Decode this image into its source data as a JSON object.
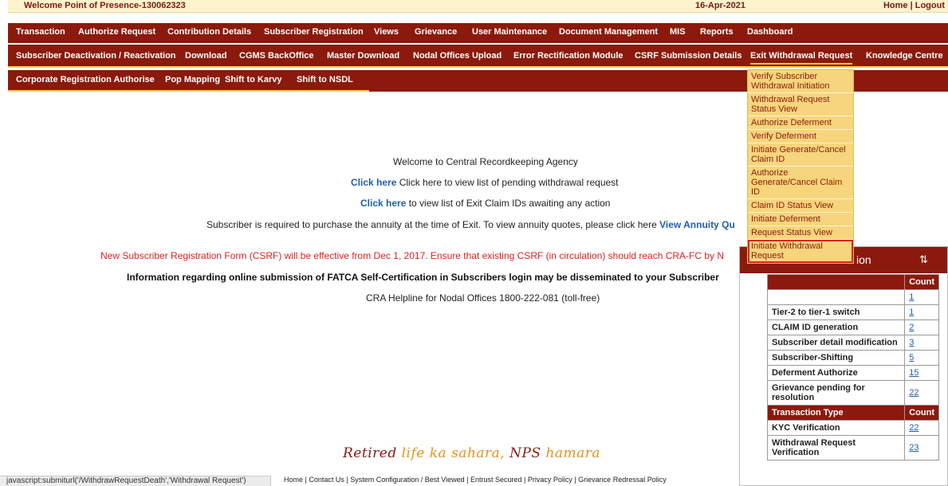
{
  "header": {
    "welcome": "Welcome Point of Presence-130062323",
    "date": "16-Apr-2021",
    "home": "Home",
    "sep": " | ",
    "logout": "Logout"
  },
  "nav_row1": [
    "Transaction",
    "Authorize Request",
    "Contribution Details",
    "Subscriber Registration",
    "Views",
    "Grievance",
    "User Maintenance",
    "Document Management",
    "MIS",
    "Reports",
    "Dashboard"
  ],
  "nav_row2": [
    "Subscriber Deactivation / Reactivation",
    "Download",
    "CGMS BackOffice",
    "Master Download",
    "Nodal Offices Upload",
    "Error Rectification Module",
    "CSRF Submission Details",
    "Exit Withdrawal Request",
    "Knowledge Centre"
  ],
  "nav_row3": [
    "Corporate Registration Authorise",
    "Pop Mapping",
    "Shift to Karvy",
    "Shift to NSDL"
  ],
  "dropdown": [
    "Verify Subscriber Withdrawal Initiation",
    "Withdrawal Request Status View",
    "Authorize Deferment",
    "Verify Deferment",
    "Initiate Generate/Cancel Claim ID",
    "Authorize Generate/Cancel Claim ID",
    "Claim ID Status View",
    "Initiate Deferment",
    "Request Status View",
    "Initiate Withdrawal Request"
  ],
  "main": {
    "welcome": "Welcome to Central Recordkeeping Agency",
    "click_here_1": "Click here",
    "line1_rest": " Click here to view list of pending withdrawal request",
    "click_here_2": "Click here",
    "line2_rest": " to view list of Exit Claim IDs awaiting any action",
    "annuity_text": "Subscriber is required to purchase the annuity at the time of Exit. To view annuity quotes, please click here ",
    "annuity_link": "View Annuity Qu",
    "csrf_notice": "New Subscriber Registration Form (CSRF) will be effective from Dec 1, 2017. Ensure that existing CSRF (in circulation) should reach CRA-FC by N",
    "fatca_notice": "Information regarding online submission of FATCA Self-Certification in Subscribers login may be disseminated to your Subscriber",
    "helpline": "CRA Helpline for Nodal Offices 1800-222-081 (toll-free)"
  },
  "panel": {
    "title": "ion",
    "count_header": "Count",
    "rows1": [
      {
        "label": "",
        "count": "1"
      },
      {
        "label": "Tier-2 to tier-1 switch",
        "count": "1"
      },
      {
        "label": "CLAIM ID generation",
        "count": "2"
      },
      {
        "label": "Subscriber detail modification",
        "count": "3"
      },
      {
        "label": "Subscriber-Shifting",
        "count": "5"
      },
      {
        "label": "Deferment Authorize",
        "count": "15"
      },
      {
        "label": "Grievance pending for resolution",
        "count": "22"
      }
    ],
    "section2_header": "Transaction Type",
    "section2_count": "Count",
    "rows2": [
      {
        "label": "KYC Verification",
        "count": "22"
      },
      {
        "label": "Withdrawal Request Verification",
        "count": "23"
      }
    ]
  },
  "tagline": {
    "part1": "Retired ",
    "part2": "life ka sahara, ",
    "part3": "NPS ",
    "part4": "hamara"
  },
  "footer": "Home | Contact Us | System Configuration / Best Viewed | Entrust Secured | Privacy Policy | Grievance Redressal Policy",
  "status_bar": "javascript:submiturl('/WithdrawRequestDeath','Withdrawal Request')"
}
